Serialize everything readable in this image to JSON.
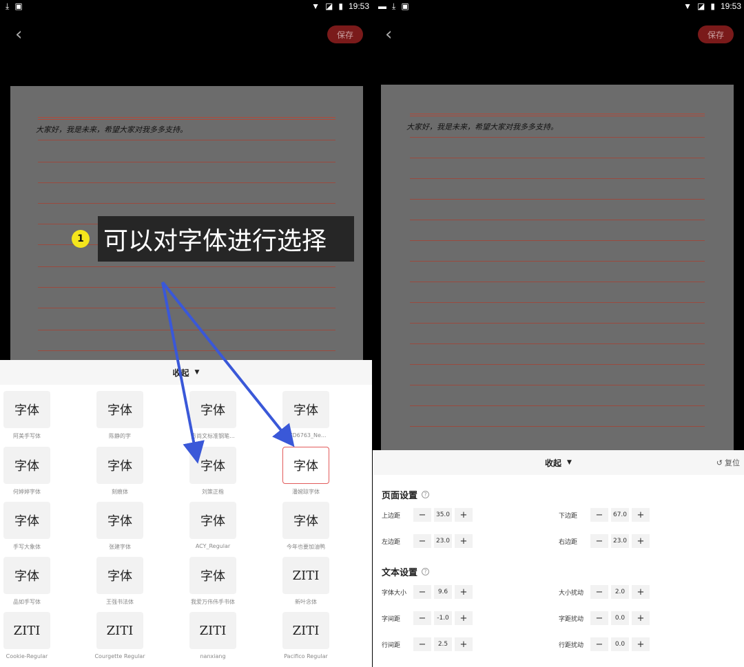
{
  "status": {
    "time": "19:53"
  },
  "header": {
    "save_label": "保存"
  },
  "paper": {
    "handwriting": "大家好，我是未来，希望大家对我多多支持。"
  },
  "annotation": {
    "step": "1",
    "text": "可以对字体进行选择"
  },
  "font_sheet": {
    "collapse_label": "收起",
    "sample": "字体",
    "fonts": [
      {
        "name": "阿美手写体",
        "preview": "字体"
      },
      {
        "name": "陈静的字",
        "preview": "字体"
      },
      {
        "name": "方尚文标准钢笔...",
        "preview": "字体"
      },
      {
        "name": "FZD6763_Ne...",
        "preview": "字体"
      },
      {
        "name": "何婷婷字体",
        "preview": "字体"
      },
      {
        "name": "刻痕体",
        "preview": "字体"
      },
      {
        "name": "刘策正楷",
        "preview": "字体"
      },
      {
        "name": "潘婉琼字体",
        "preview": "字体"
      },
      {
        "name": "手写大象体",
        "preview": "字体"
      },
      {
        "name": "张建字体",
        "preview": "字体"
      },
      {
        "name": "ACY_Regular",
        "preview": "字体"
      },
      {
        "name": "今年也要加油鸭",
        "preview": "字体"
      },
      {
        "name": "品如手写体",
        "preview": "字体"
      },
      {
        "name": "王强书法体",
        "preview": "字体"
      },
      {
        "name": "我爱万伟伟手书体",
        "preview": "字体"
      },
      {
        "name": "新叶念体",
        "preview": "ZITI"
      },
      {
        "name": "Cookie-Regular",
        "preview": "ZITI"
      },
      {
        "name": "Courgette Regular",
        "preview": "ZITI"
      },
      {
        "name": "nanxiang",
        "preview": "ZITI"
      },
      {
        "name": "Pacifico Regular",
        "preview": "ZITI"
      }
    ]
  },
  "settings_sheet": {
    "collapse_label": "收起",
    "reset_label": "复位",
    "page_section": "页面设置",
    "text_section": "文本设置",
    "page_rows": [
      {
        "label": "上边距",
        "value": "35.0"
      },
      {
        "label": "下边距",
        "value": "67.0"
      },
      {
        "label": "左边距",
        "value": "23.0"
      },
      {
        "label": "右边距",
        "value": "23.0"
      }
    ],
    "text_rows": [
      {
        "label": "字体大小",
        "value": "9.6"
      },
      {
        "label": "大小扰动",
        "value": "2.0"
      },
      {
        "label": "字间距",
        "value": "-1.0"
      },
      {
        "label": "字距扰动",
        "value": "0.0"
      },
      {
        "label": "行间距",
        "value": "2.5"
      },
      {
        "label": "行距扰动",
        "value": "0.0"
      }
    ],
    "minus": "−",
    "plus": "+"
  }
}
